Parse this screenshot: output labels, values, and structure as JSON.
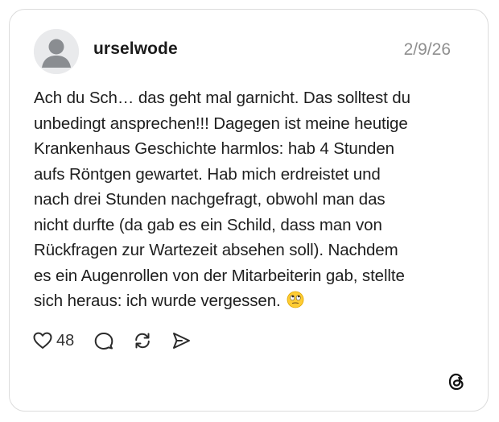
{
  "post": {
    "username": "urselwode",
    "date": "2/9/26",
    "text": "Ach du Sch… das geht mal garnicht. Das solltest du\nunbedingt ansprechen!!! Dagegen ist meine heutige\nKrankenhaus Geschichte harmlos: hab 4 Stunden\naufs Röntgen gewartet. Hab mich erdreistet und\nnach drei Stunden nachgefragt, obwohl man das\nnicht durfte (da gab es ein Schild, dass man von\nRückfragen zur Wartezeit absehen soll). Nachdem\nes ein Augenrollen von der Mitarbeiterin gab, stellte\nsich heraus: ich wurde vergessen. ",
    "emoji": "face-with-rolling-eyes"
  },
  "actions": {
    "like_count": "48",
    "like_icon": "heart-icon",
    "reply_icon": "comment-icon",
    "repost_icon": "repost-icon",
    "share_icon": "send-icon"
  },
  "branding": {
    "logo": "threads-logo-icon"
  }
}
